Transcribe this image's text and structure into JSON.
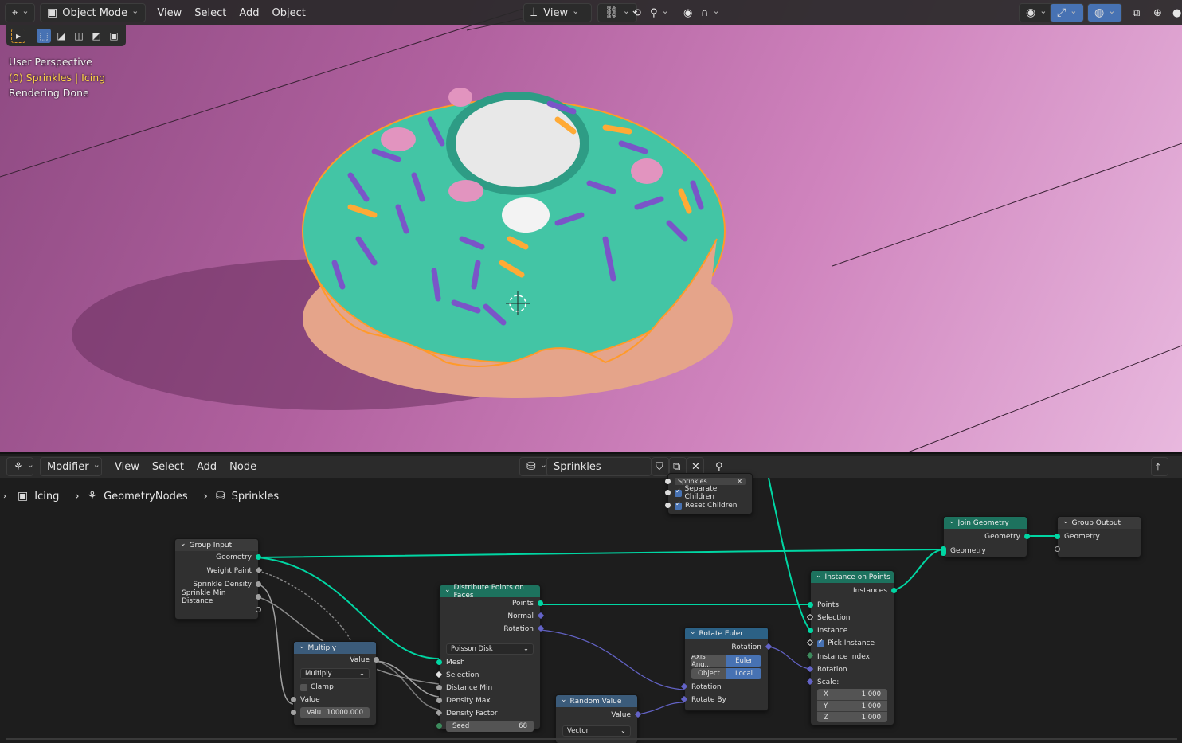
{
  "viewport": {
    "mode": "Object Mode",
    "menu": [
      "View",
      "Select",
      "Add",
      "Object"
    ],
    "transform_orientation": "View",
    "overlay_info": {
      "line1": "User Perspective",
      "line2": "(0) Sprinkles | Icing",
      "line3": "Rendering Done"
    },
    "accent_colors": {
      "icing": "#43c5a5",
      "outline": "#ff9a2a",
      "sprinkle": "#7a55c8",
      "background": "#b1619f"
    }
  },
  "node_editor": {
    "editor_type": "Modifier",
    "menu": [
      "View",
      "Select",
      "Add",
      "Node"
    ],
    "node_group": "Sprinkles",
    "breadcrumb": [
      "Icing",
      "GeometryNodes",
      "Sprinkles"
    ],
    "nodes": {
      "collection_info": {
        "collection": "Sprinkles",
        "separate_children": "Separate Children",
        "reset_children": "Reset Children"
      },
      "group_input": {
        "title": "Group Input",
        "outputs": [
          "Geometry",
          "Weight Paint",
          "Sprinkle Density",
          "Sprinkle Min Distance"
        ]
      },
      "multiply": {
        "title": "Multiply",
        "out": "Value",
        "op": "Multiply",
        "clamp": "Clamp",
        "in": "Value",
        "val_label": "Valu",
        "val": "10000.000"
      },
      "distribute": {
        "title": "Distribute Points on Faces",
        "outputs": [
          "Points",
          "Normal",
          "Rotation"
        ],
        "method": "Poisson Disk",
        "inputs": [
          "Mesh",
          "Selection",
          "Distance Min",
          "Density Max",
          "Density Factor"
        ],
        "seed_label": "Seed",
        "seed": "68"
      },
      "random_value": {
        "title": "Random Value",
        "out": "Value",
        "type": "Vector"
      },
      "rotate_euler": {
        "title": "Rotate Euler",
        "out": "Rotation",
        "mode_a": "Axis Ang...",
        "mode_b": "Euler",
        "space_a": "Object",
        "space_b": "Local",
        "in1": "Rotation",
        "in2": "Rotate By"
      },
      "instance_on_points": {
        "title": "Instance on Points",
        "out": "Instances",
        "inputs": [
          "Points",
          "Selection",
          "Instance"
        ],
        "pick": "Pick Instance",
        "inputs2": [
          "Instance Index",
          "Rotation",
          "Scale:"
        ],
        "scale": [
          {
            "axis": "X",
            "val": "1.000"
          },
          {
            "axis": "Y",
            "val": "1.000"
          },
          {
            "axis": "Z",
            "val": "1.000"
          }
        ]
      },
      "join_geometry": {
        "title": "Join Geometry",
        "out": "Geometry",
        "in": "Geometry"
      },
      "group_output": {
        "title": "Group Output",
        "in": "Geometry"
      }
    }
  }
}
